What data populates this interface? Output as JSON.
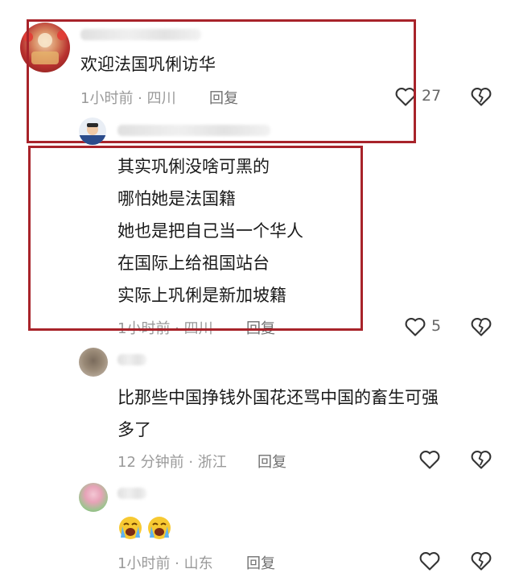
{
  "comments": [
    {
      "text": "欢迎法国巩俐访华",
      "meta": "1小时前 · 四川",
      "reply_label": "回复",
      "like_count": "27"
    },
    {
      "lines": [
        "其实巩俐没啥可黑的",
        "哪怕她是法国籍",
        "她也是把自己当一个华人",
        "在国际上给祖国站台",
        "实际上巩俐是新加坡籍"
      ],
      "meta": "1小时前 · 四川",
      "reply_label": "回复",
      "like_count": "5"
    },
    {
      "lines": [
        "比那些中国挣钱外国花还骂中国的畜生可强",
        "多了"
      ],
      "meta": "12 分钟前 · 浙江",
      "reply_label": "回复"
    },
    {
      "emoji": [
        "loudly-crying-face-emoji",
        "loudly-crying-face-emoji"
      ],
      "meta": "1小时前 · 山东",
      "reply_label": "回复"
    }
  ],
  "colors": {
    "highlight_box": "#a8232a",
    "meta_text": "#9a9a9a",
    "icon_stroke": "#333333"
  },
  "icons": [
    "heart-outline-icon",
    "broken-heart-icon"
  ]
}
